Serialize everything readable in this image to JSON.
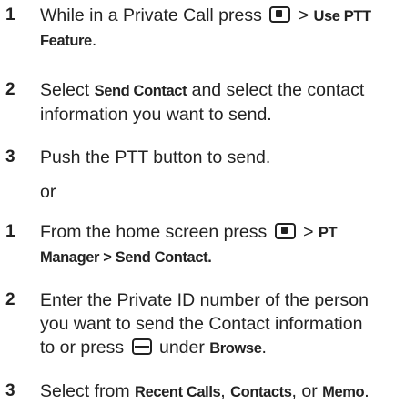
{
  "method1": {
    "step1": {
      "num": "1",
      "text_a": "While in a Private Call press",
      "sep": ">",
      "cmd_a": "Use PTT",
      "cmd_b": "Feature",
      "end": "."
    },
    "step2": {
      "num": "2",
      "text_a": "Select",
      "cmd_a": "Send Contact",
      "text_b": "and select the contact",
      "text_c": "information you want to send."
    },
    "step3": {
      "num": "3",
      "text_a": "Push the PTT button to send."
    }
  },
  "or_label": "or",
  "method2": {
    "step1": {
      "num": "1",
      "text_a": "From the home screen press",
      "sep": ">",
      "cmd_a": "PT",
      "cmd_b": "Manager > Send Contact."
    },
    "step2": {
      "num": "2",
      "text_a": "Enter the Private ID number of the person",
      "text_b": "you want to send the Contact information",
      "text_c": "to or press",
      "text_d": "under",
      "cmd_a": "Browse",
      "end": "."
    },
    "step3": {
      "num": "3",
      "text_a": "Select from",
      "cmd_a": "Recent Calls",
      "text_b": ",",
      "cmd_b": "Contacts",
      "text_c": ", or",
      "cmd_c": "Memo",
      "end": "."
    }
  },
  "icons": {
    "menu_key": "menu-key-icon",
    "softkey": "softkey-icon"
  }
}
